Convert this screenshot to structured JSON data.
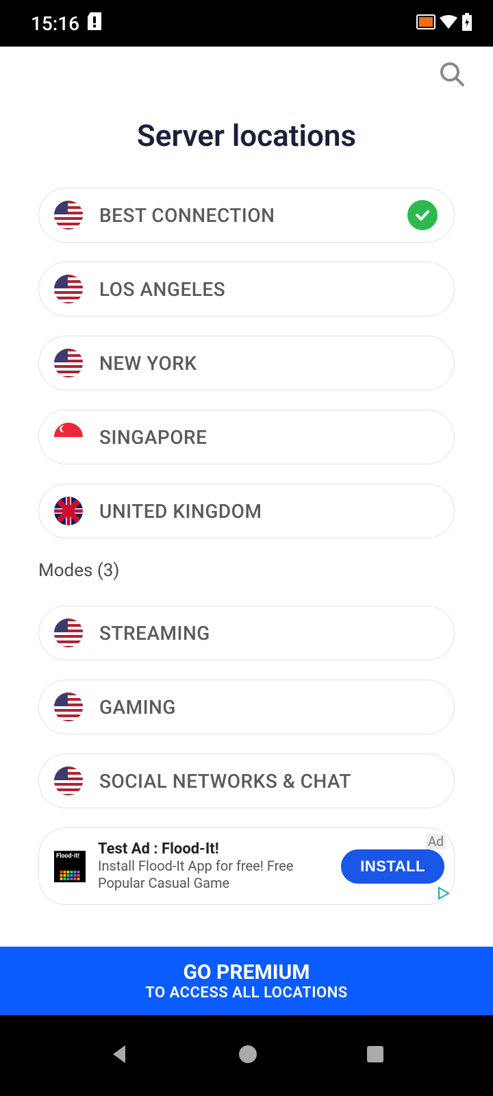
{
  "status": {
    "time": "15:16"
  },
  "page": {
    "title": "Server locations"
  },
  "servers": [
    {
      "label": "BEST CONNECTION",
      "flag": "us",
      "selected": true
    },
    {
      "label": "LOS ANGELES",
      "flag": "us",
      "selected": false
    },
    {
      "label": "NEW YORK",
      "flag": "us",
      "selected": false
    },
    {
      "label": "SINGAPORE",
      "flag": "sg",
      "selected": false
    },
    {
      "label": "UNITED KINGDOM",
      "flag": "uk",
      "selected": false
    }
  ],
  "modes_header": "Modes (3)",
  "modes": [
    {
      "label": "STREAMING",
      "flag": "us"
    },
    {
      "label": "GAMING",
      "flag": "us"
    },
    {
      "label": "SOCIAL NETWORKS & CHAT",
      "flag": "us"
    }
  ],
  "ad": {
    "tag": "Ad",
    "title": "Test Ad : Flood-It!",
    "desc": "Install Flood-It App for free! Free Popular Casual Game",
    "button": "INSTALL",
    "icon_label": "Flood-it!"
  },
  "premium": {
    "title": "GO PREMIUM",
    "subtitle": "TO ACCESS ALL LOCATIONS"
  }
}
